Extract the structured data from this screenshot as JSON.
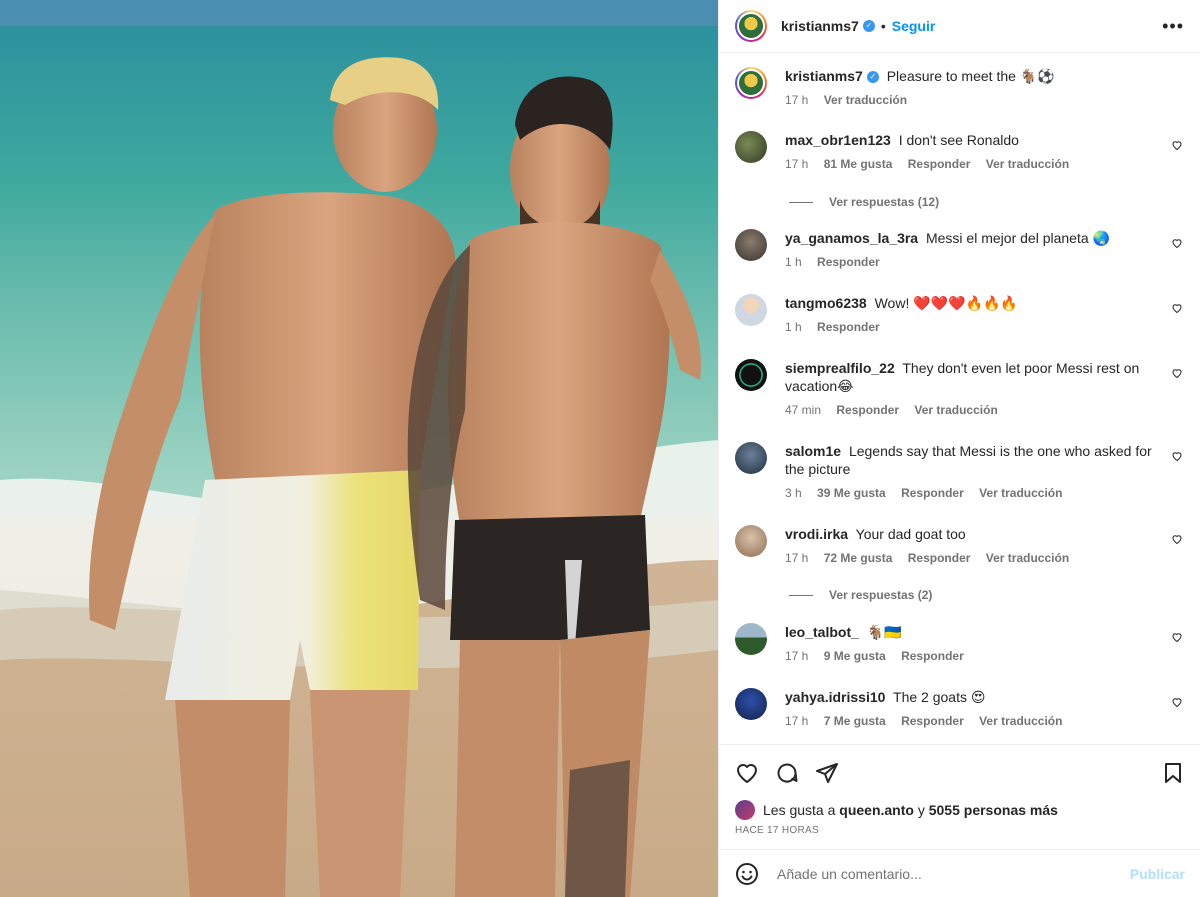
{
  "post": {
    "image_alt": "",
    "header": {
      "username": "kristianms7",
      "separator": "•",
      "follow_label": "Seguir"
    },
    "caption": {
      "username": "kristianms7",
      "text": "Pleasure to meet the 🐐⚽",
      "time": "17 h",
      "translate": "Ver traducción"
    },
    "comments": [
      {
        "user": "max_obr1en123",
        "text": "I don't see Ronaldo",
        "time": "17 h",
        "likes": "81 Me gusta",
        "reply": "Responder",
        "translate": "Ver traducción",
        "view_replies": "Ver respuestas (12)"
      },
      {
        "user": "ya_ganamos_la_3ra",
        "text": "Messi el mejor del planeta 🌏",
        "time": "1 h",
        "likes": "",
        "reply": "Responder",
        "translate": ""
      },
      {
        "user": "tangmo6238",
        "text": "Wow! ❤️❤️❤️🔥🔥🔥",
        "time": "1 h",
        "likes": "",
        "reply": "Responder",
        "translate": ""
      },
      {
        "user": "siemprealfilo_22",
        "text": "They don't even let poor Messi rest on vacation😂",
        "time": "47 min",
        "likes": "",
        "reply": "Responder",
        "translate": "Ver traducción"
      },
      {
        "user": "salom1e",
        "text": "Legends say that Messi is the one who asked for the picture",
        "time": "3 h",
        "likes": "39 Me gusta",
        "reply": "Responder",
        "translate": "Ver traducción"
      },
      {
        "user": "vrodi.irka",
        "text": "Your dad goat too",
        "time": "17 h",
        "likes": "72 Me gusta",
        "reply": "Responder",
        "translate": "Ver traducción",
        "view_replies": "Ver respuestas (2)"
      },
      {
        "user": "leo_talbot_",
        "text": "🐐🇺🇦",
        "time": "17 h",
        "likes": "9 Me gusta",
        "reply": "Responder",
        "translate": ""
      },
      {
        "user": "yahya.idrissi10",
        "text": "The 2 goats 😍",
        "time": "17 h",
        "likes": "7 Me gusta",
        "reply": "Responder",
        "translate": "Ver traducción"
      }
    ],
    "likes_line": {
      "prefix": "Les gusta a",
      "user": "queen.anto",
      "middle": "y",
      "count": "5055 personas más"
    },
    "timestamp": "HACE 17 HORAS",
    "add_comment": {
      "placeholder": "Añade un comentario...",
      "publish_label": "Publicar"
    }
  },
  "icons": [
    "heart-icon",
    "comment-icon",
    "share-icon",
    "bookmark-icon",
    "emoji-icon",
    "more-options-icon",
    "verified-icon"
  ],
  "colors": {
    "accent": "#0095f6",
    "text": "#262626",
    "muted": "#737373",
    "publish_disabled": "#b2dffc"
  }
}
